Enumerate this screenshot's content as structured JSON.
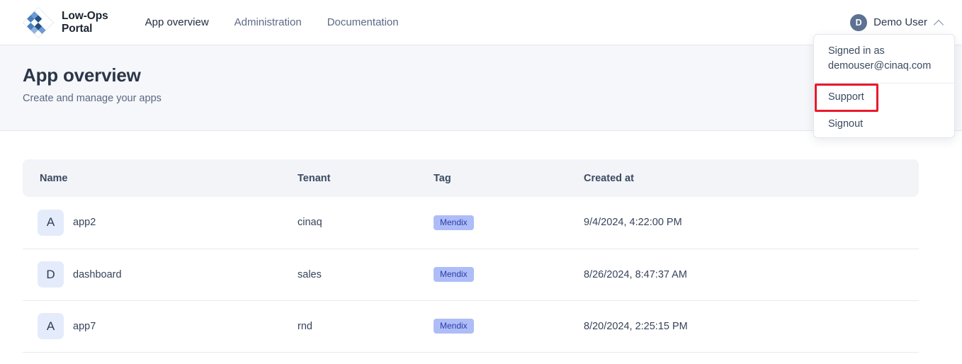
{
  "brand": {
    "line1": "Low-Ops",
    "line2": "Portal",
    "logo_icon": "diamond-grid-logo-icon"
  },
  "nav": {
    "links": [
      {
        "label": "App overview",
        "active": true
      },
      {
        "label": "Administration",
        "active": false
      },
      {
        "label": "Documentation",
        "active": false
      }
    ]
  },
  "user_menu": {
    "avatar_initial": "D",
    "name": "Demo User",
    "chevron_icon": "chevron-up-icon",
    "dropdown": {
      "signed_in_label": "Signed in as",
      "email": "demouser@cinaq.com",
      "items": [
        {
          "label": "Support",
          "highlighted": true
        },
        {
          "label": "Signout",
          "highlighted": false
        }
      ]
    }
  },
  "page": {
    "title": "App overview",
    "subtitle": "Create and manage your apps"
  },
  "table": {
    "columns": [
      "Name",
      "Tenant",
      "Tag",
      "Created at"
    ],
    "rows": [
      {
        "avatar_initial": "A",
        "name": "app2",
        "tenant": "cinaq",
        "tag": "Mendix",
        "created_at": "9/4/2024, 4:22:00 PM"
      },
      {
        "avatar_initial": "D",
        "name": "dashboard",
        "tenant": "sales",
        "tag": "Mendix",
        "created_at": "8/26/2024, 8:47:37 AM"
      },
      {
        "avatar_initial": "A",
        "name": "app7",
        "tenant": "rnd",
        "tag": "Mendix",
        "created_at": "8/20/2024, 2:25:15 PM"
      }
    ]
  },
  "colors": {
    "highlight_box": "#e8192c",
    "tag_bg": "#aebdf7",
    "tag_text": "#2a3da8",
    "avatar_bg": "#5b7290",
    "app_avatar_bg": "#e4ebfb",
    "band_bg": "#f6f7fa",
    "table_header_bg": "#f2f4f8"
  }
}
